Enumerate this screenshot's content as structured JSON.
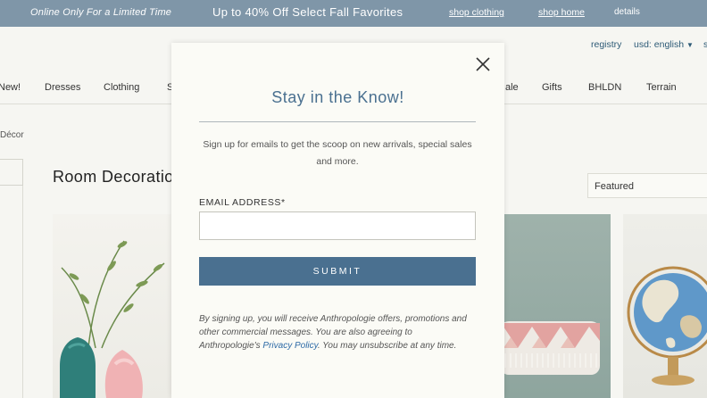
{
  "promo": {
    "online_only": "Online Only For a Limited Time",
    "sale_text": "Up to 40% Off Select Fall Favorites",
    "shop_clothing": "shop clothing",
    "shop_home": "shop home",
    "details": "details"
  },
  "header": {
    "registry": "registry",
    "currency": "usd: english",
    "currency_caret": "▼",
    "cut_link": "s"
  },
  "nav": {
    "items": [
      "New!",
      "Dresses",
      "Clothing",
      "S",
      "ale",
      "Gifts",
      "BHLDN",
      "Terrain"
    ]
  },
  "breadcrumb": "Décor",
  "page_title": "Room Decoratio",
  "sort": {
    "selected": "Featured"
  },
  "modal": {
    "title": "Stay in the Know!",
    "description": "Sign up for emails to get the scoop on new arrivals, special sales and more.",
    "email_label": "EMAIL ADDRESS*",
    "email_value": "",
    "submit_label": "SUBMIT",
    "legal_part1": "By signing up, you will receive Anthropologie offers, promotions and other commercial messages. You are also agreeing to Anthropologie's ",
    "privacy_link": "Privacy Policy",
    "legal_part2": ". You may unsubscribe at any time."
  },
  "colors": {
    "promo_bg": "#7f96a8",
    "accent": "#4a7090",
    "link": "#2d5a76",
    "modal_bg": "#fbfbf6"
  },
  "icons": {
    "close": "close-icon",
    "caret": "caret-down-icon"
  }
}
